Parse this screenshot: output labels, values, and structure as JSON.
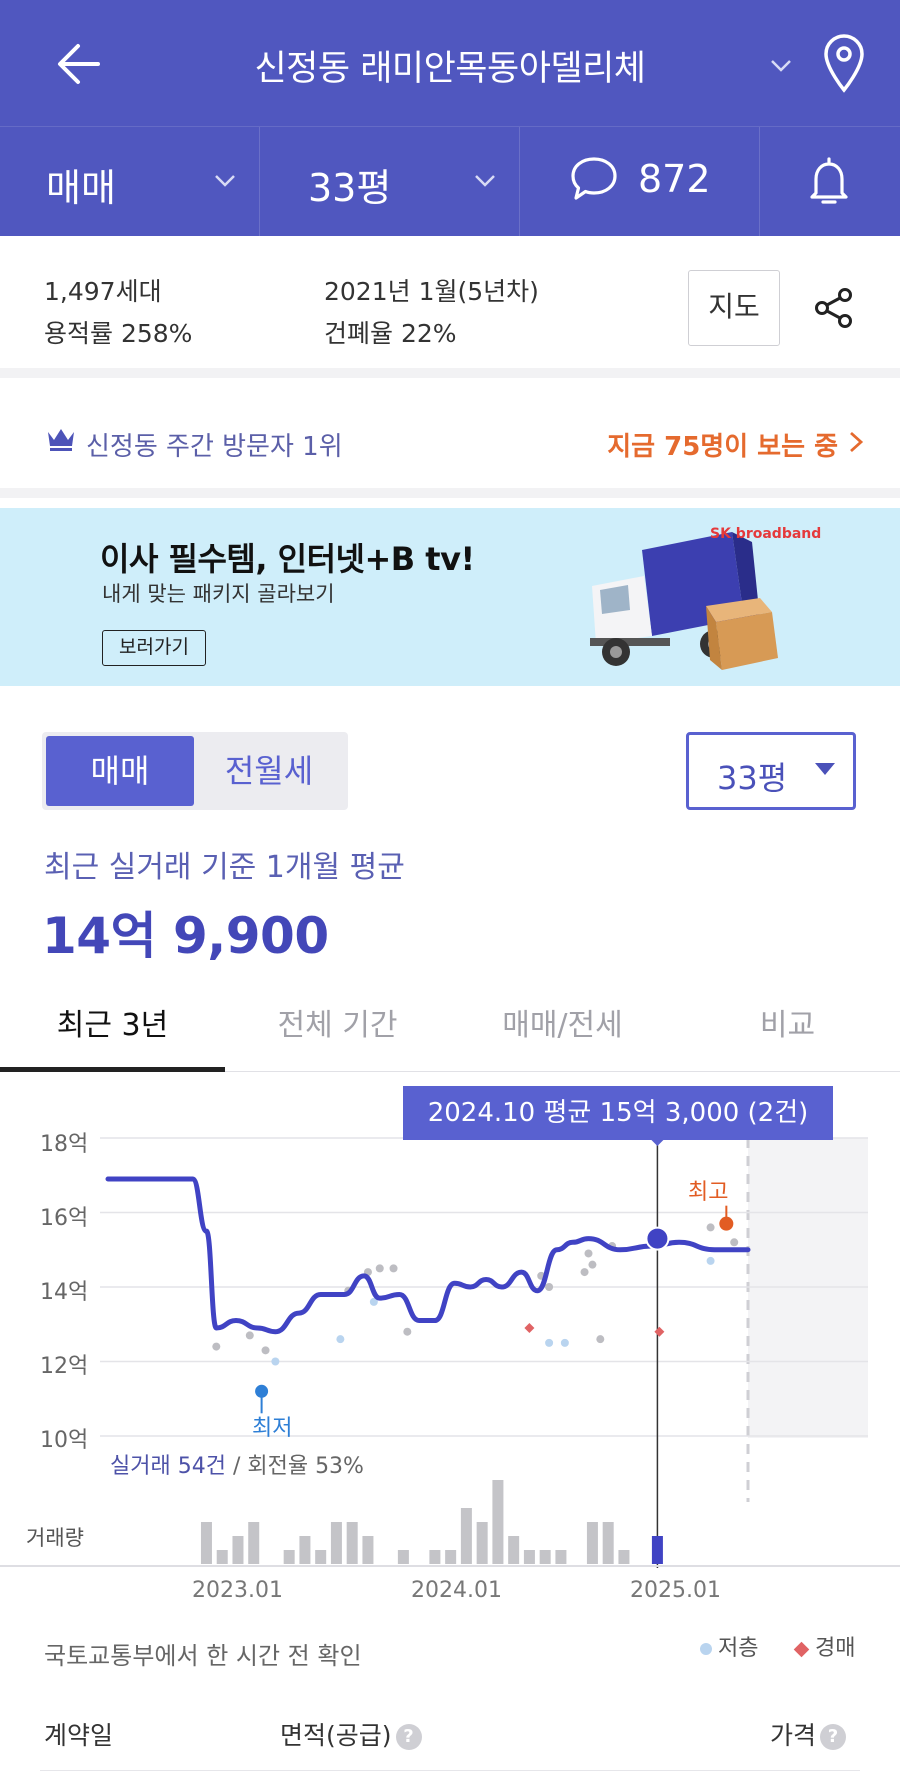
{
  "header": {
    "title": "신정동 래미안목동아델리체",
    "deal_type": "매매",
    "size": "33평",
    "comment_count": "872",
    "brand_color": "#5057bf"
  },
  "info": {
    "households": "1,497세대",
    "floor_area_ratio": "용적률 258%",
    "built": "2021년 1월(5년차)",
    "building_coverage": "건폐율 22%",
    "map_button": "지도"
  },
  "visitors": {
    "rank_text": "신정동 주간 방문자 1위",
    "viewing_now": "지금 75명이 보는 중"
  },
  "banner": {
    "headline": "이사 필수템, 인터넷+B tv!",
    "subline": "내게 맞는 패키지 골라보기",
    "button": "보러가기",
    "brand": "SK broadband"
  },
  "price": {
    "toggle_sale": "매매",
    "toggle_rent": "전월세",
    "size_select": "33평",
    "avg_label": "최근 실거래 기준 1개월 평균",
    "avg_value": "14억 9,900",
    "accent_color": "#4347b8"
  },
  "tabs": [
    "최근 3년",
    "전체 기간",
    "매매/전세",
    "비교"
  ],
  "chart": {
    "tooltip": "2024.10 평균 15억 3,000 (2건)",
    "min_label": "최저",
    "max_label": "최고",
    "stats_count": "실거래 54건",
    "stats_rate": " / 회전율 53%",
    "volume_label": "거래량"
  },
  "chart_data": {
    "type": "line",
    "y_unit": "억",
    "ylim": [
      10,
      18
    ],
    "y_ticks": [
      "18억",
      "16억",
      "14억",
      "12억",
      "10억"
    ],
    "x_ticks": [
      "2023.01",
      "2024.01",
      "2025.01"
    ],
    "series": [
      {
        "values": [
          [
            2022.0,
            16.9
          ],
          [
            2022.43,
            16.9
          ],
          [
            2022.5,
            15.5
          ],
          [
            2022.55,
            12.9
          ],
          [
            2022.65,
            13.1
          ],
          [
            2022.76,
            12.9
          ],
          [
            2022.85,
            12.8
          ],
          [
            2022.97,
            13.3
          ],
          [
            2023.08,
            13.8
          ],
          [
            2023.2,
            13.8
          ],
          [
            2023.3,
            14.3
          ],
          [
            2023.38,
            13.7
          ],
          [
            2023.48,
            13.8
          ],
          [
            2023.58,
            13.1
          ],
          [
            2023.66,
            13.1
          ],
          [
            2023.76,
            14.1
          ],
          [
            2023.84,
            14.0
          ],
          [
            2023.92,
            14.2
          ],
          [
            2024.0,
            14.0
          ],
          [
            2024.1,
            14.4
          ],
          [
            2024.18,
            13.9
          ],
          [
            2024.28,
            15.0
          ],
          [
            2024.36,
            15.2
          ],
          [
            2024.44,
            15.3
          ],
          [
            2024.6,
            15.0
          ],
          [
            2024.76,
            15.1
          ],
          [
            2024.9,
            15.2
          ],
          [
            2025.08,
            15.0
          ],
          [
            2025.25,
            15.0
          ]
        ]
      }
    ],
    "highlight": {
      "x": 2024.79,
      "y": 15.3
    },
    "min_point": {
      "x": 2022.78,
      "y": 11.2
    },
    "max_point": {
      "x": 2025.14,
      "y": 15.7
    },
    "scatter_normal": [
      [
        2022.55,
        12.4
      ],
      [
        2022.72,
        12.7
      ],
      [
        2022.8,
        12.3
      ],
      [
        2023.22,
        13.9
      ],
      [
        2023.32,
        14.4
      ],
      [
        2023.38,
        14.5
      ],
      [
        2023.45,
        14.5
      ],
      [
        2023.52,
        12.8
      ],
      [
        2024.2,
        14.3
      ],
      [
        2024.24,
        14.0
      ],
      [
        2024.42,
        14.4
      ],
      [
        2024.44,
        14.9
      ],
      [
        2024.46,
        14.6
      ],
      [
        2024.5,
        12.6
      ],
      [
        2024.56,
        15.1
      ],
      [
        2025.06,
        15.6
      ],
      [
        2025.18,
        15.2
      ]
    ],
    "scatter_low": [
      [
        2022.85,
        12.0
      ],
      [
        2023.18,
        12.6
      ],
      [
        2023.35,
        13.6
      ],
      [
        2024.24,
        12.5
      ],
      [
        2024.32,
        12.5
      ],
      [
        2025.06,
        14.7
      ]
    ],
    "scatter_auction": [
      [
        2024.14,
        12.9
      ],
      [
        2024.8,
        12.8
      ]
    ],
    "volume": [
      [
        2022.5,
        3
      ],
      [
        2022.58,
        1
      ],
      [
        2022.66,
        2
      ],
      [
        2022.74,
        3
      ],
      [
        2022.92,
        1
      ],
      [
        2023.0,
        2
      ],
      [
        2023.08,
        1
      ],
      [
        2023.16,
        3
      ],
      [
        2023.24,
        3
      ],
      [
        2023.32,
        2
      ],
      [
        2023.5,
        1
      ],
      [
        2023.66,
        1
      ],
      [
        2023.74,
        1
      ],
      [
        2023.82,
        4
      ],
      [
        2023.9,
        3
      ],
      [
        2023.98,
        6
      ],
      [
        2024.06,
        2
      ],
      [
        2024.14,
        1
      ],
      [
        2024.22,
        1
      ],
      [
        2024.3,
        1
      ],
      [
        2024.46,
        3
      ],
      [
        2024.54,
        3
      ],
      [
        2024.62,
        1
      ]
    ],
    "volume_highlight": [
      2024.79,
      2
    ],
    "legend": [
      "저층",
      "경매"
    ]
  },
  "footer": {
    "source": "국토교통부에서 한 시간 전 확인",
    "legend_low": "저층",
    "legend_auction": "경매",
    "col_date": "계약일",
    "col_area": "면적(공급)",
    "col_price": "가격"
  }
}
